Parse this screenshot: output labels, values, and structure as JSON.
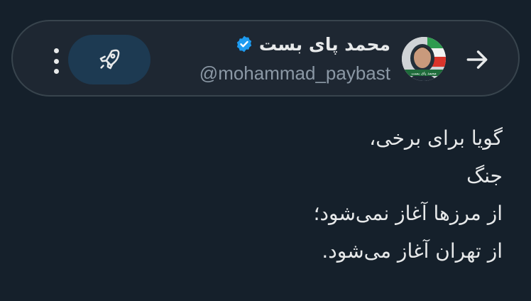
{
  "header": {
    "display_name": "محمد پای بست",
    "handle": "@mohammad_paybast",
    "verified": true,
    "avatar_caption": "محمد پای بست",
    "icons": {
      "back": "arrow-right-icon",
      "verified": "verified-badge-icon",
      "boost": "rocket-icon",
      "more": "more-vertical-icon"
    }
  },
  "post": {
    "lines": [
      "گویا برای برخی،",
      "جنگ",
      "از مرزها آغاز نمی‌شود؛",
      "از تهران آغاز می‌شود."
    ]
  },
  "colors": {
    "background": "#15202b",
    "card_background": "#1e2732",
    "card_border": "#38444d",
    "text_primary": "#e7e9ea",
    "text_secondary": "#8b98a5",
    "verified_blue": "#1d9bf0",
    "boost_button": "#1d3a52"
  }
}
